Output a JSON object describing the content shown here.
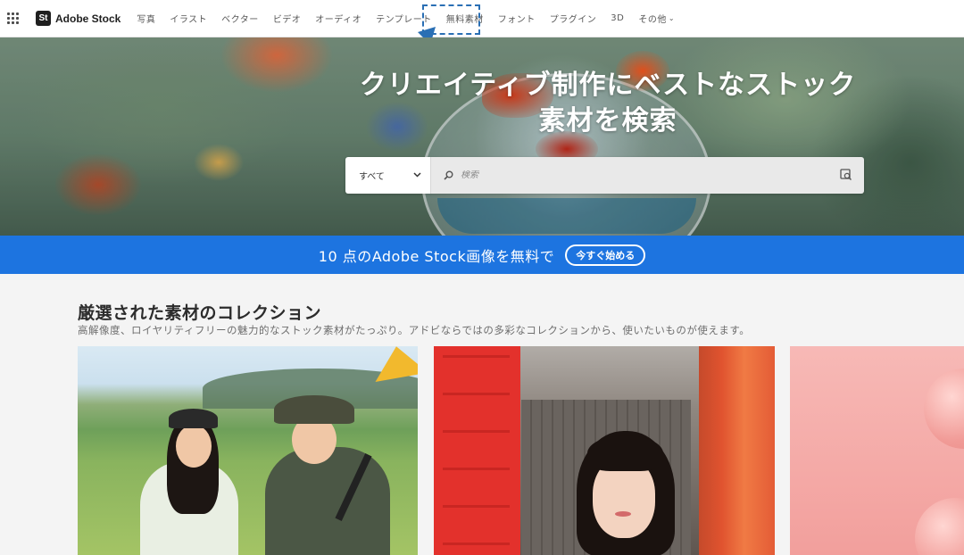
{
  "nav": {
    "logo_badge": "St",
    "logo_text": "Adobe Stock",
    "items": [
      {
        "label": "写真"
      },
      {
        "label": "イラスト"
      },
      {
        "label": "ベクター"
      },
      {
        "label": "ビデオ"
      },
      {
        "label": "オーディオ"
      },
      {
        "label": "テンプレート"
      },
      {
        "label": "無料素材"
      },
      {
        "label": "フォント"
      },
      {
        "label": "プラグイン"
      },
      {
        "label": "3D"
      },
      {
        "label": "その他"
      }
    ],
    "highlighted_item": "無料素材",
    "annotation_color": "#2a6fb4"
  },
  "hero": {
    "title": "クリエイティブ制作にベストなストック素材を検索",
    "search": {
      "category_selected": "すべて",
      "placeholder": "検索"
    }
  },
  "banner": {
    "text": "10 点のAdobe Stock画像を無料で",
    "button_label": "今すぐ始める",
    "background_color": "#1d74e0"
  },
  "collection": {
    "title": "厳選された素材のコレクション",
    "description": "高解像度、ロイヤリティフリーの魅力的なストック素材がたっぷり。アドビならではの多彩なコレクションから、使いたいものが使えます。"
  }
}
